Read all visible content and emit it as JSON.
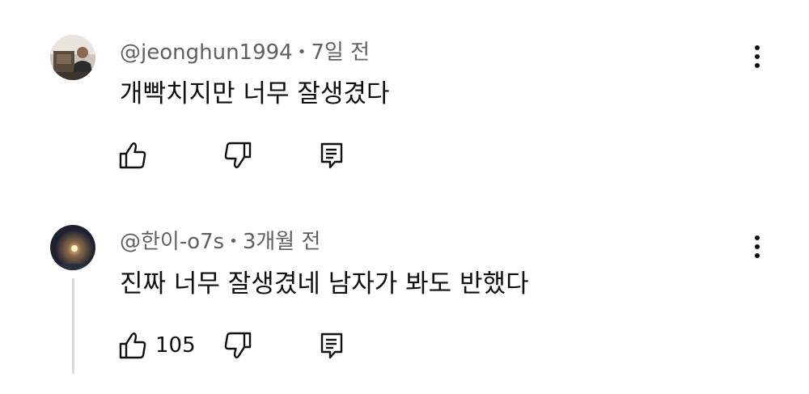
{
  "comments": [
    {
      "author": "@jeonghun1994",
      "separator": "•",
      "time": "7일 전",
      "text": "개빡치지만 너무 잘생겼다",
      "like_count": "",
      "icons": {
        "avatar": "user-avatar-photo",
        "like": "thumbs-up-icon",
        "dislike": "thumbs-down-icon",
        "reply": "reply-comment-icon",
        "menu": "more-vertical-icon"
      }
    },
    {
      "author": "@한이-o7s",
      "separator": "•",
      "time": "3개월 전",
      "text": "진짜 너무 잘생겼네 남자가 봐도 반했다",
      "like_count": "105",
      "icons": {
        "avatar": "user-avatar-photo",
        "like": "thumbs-up-icon",
        "dislike": "thumbs-down-icon",
        "reply": "reply-comment-icon",
        "menu": "more-vertical-icon"
      }
    }
  ],
  "colors": {
    "text_primary": "#0f0f0f",
    "text_secondary": "#606060",
    "thread_line": "#d9d9d9",
    "background": "#ffffff"
  }
}
